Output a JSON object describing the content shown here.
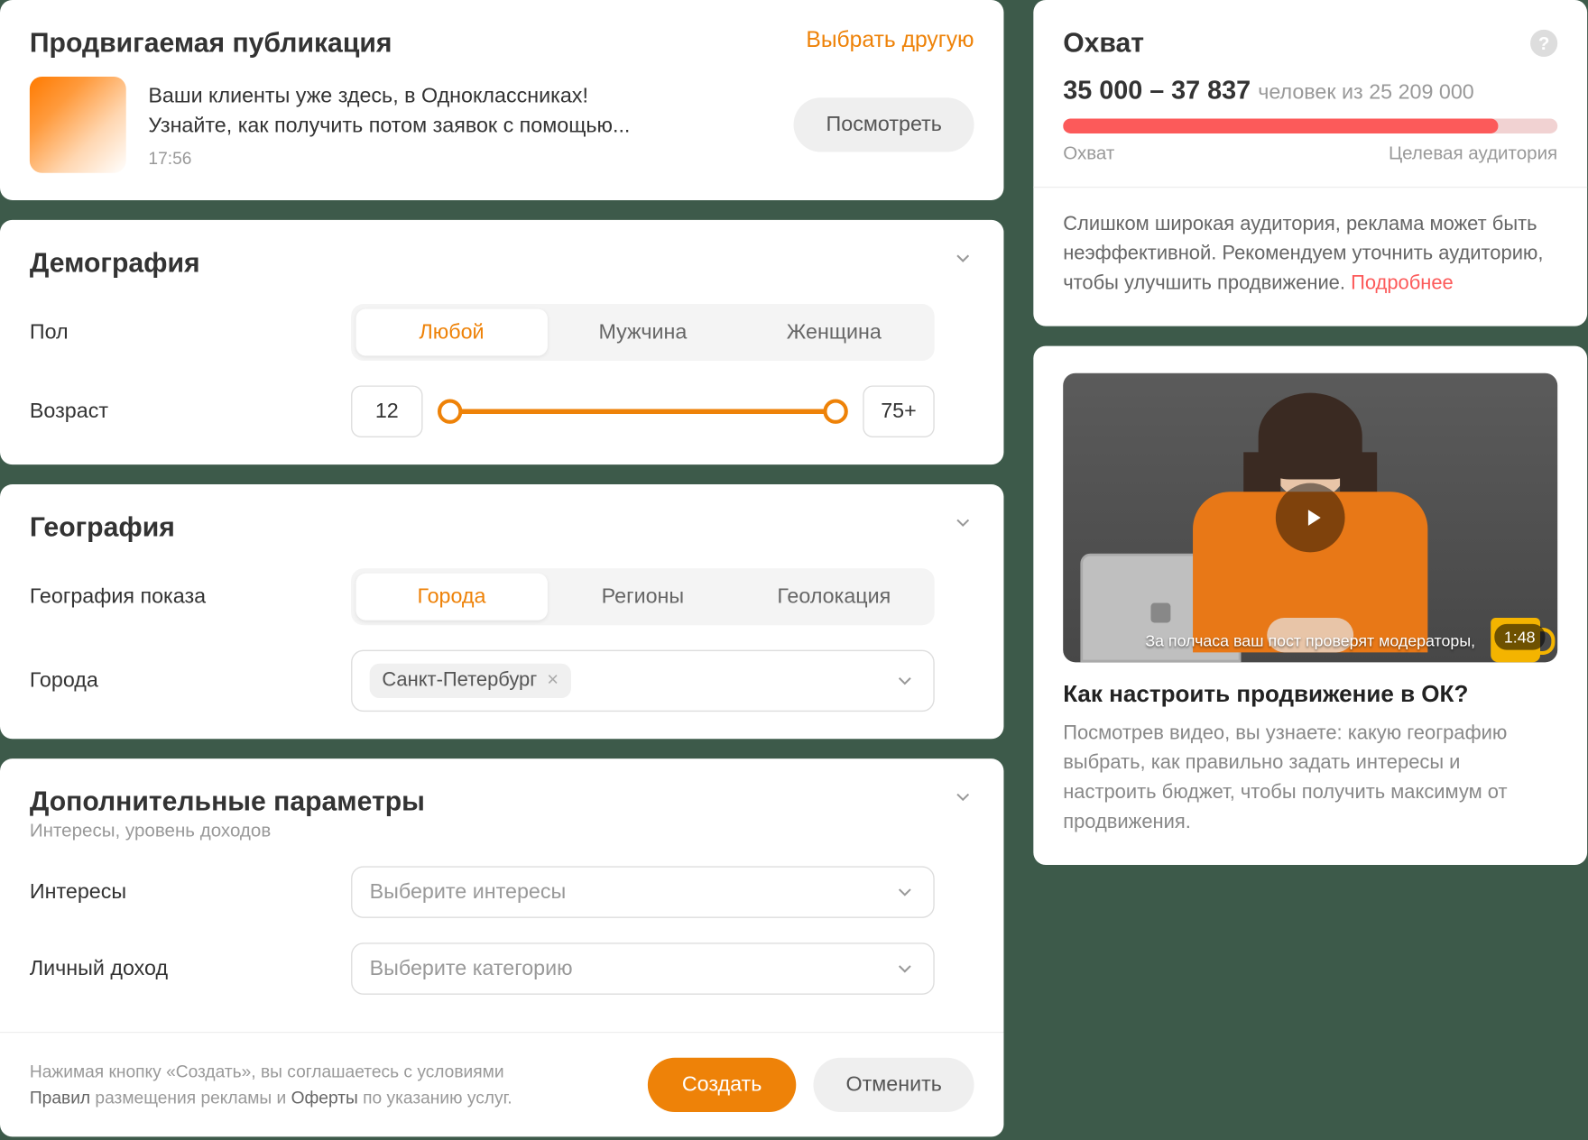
{
  "promoted": {
    "title": "Продвигаемая публикация",
    "change_link": "Выбрать другую",
    "text_line1": "Ваши клиенты уже здесь, в Одноклассниках!",
    "text_line2": "Узнайте, как получить потом заявок с помощью...",
    "time": "17:56",
    "view_btn": "Посмотреть"
  },
  "demo": {
    "title": "Демография",
    "gender_label": "Пол",
    "gender_options": {
      "any": "Любой",
      "male": "Мужчина",
      "female": "Женщина"
    },
    "age_label": "Возраст",
    "age_min": "12",
    "age_max": "75+"
  },
  "geo": {
    "title": "География",
    "type_label": "География показа",
    "type_options": {
      "cities": "Города",
      "regions": "Регионы",
      "geo": "Геолокация"
    },
    "cities_label": "Города",
    "city_chip": "Санкт-Петербург"
  },
  "params": {
    "title": "Дополнительные параметры",
    "subtitle": "Интересы, уровень доходов",
    "interests_label": "Интересы",
    "interests_placeholder": "Выберите интересы",
    "income_label": "Личный доход",
    "income_placeholder": "Выберите категорию"
  },
  "footer": {
    "legal_1": "Нажимая кнопку «Создать», вы соглашаетесь с условиями",
    "legal_rules": "Правил",
    "legal_2": " размещения рекламы и ",
    "legal_offer": "Оферты",
    "legal_3": " по указанию услуг.",
    "create": "Создать",
    "cancel": "Отменить"
  },
  "reach": {
    "title": "Охват",
    "range": "35 000 – 37 837",
    "people": "человек из 25 209 000",
    "bar_pct": 88,
    "label_left": "Охват",
    "label_right": "Целевая аудитория",
    "warn_text": "Слишком широкая аудитория, реклама может быть неэффективной. Рекомендуем уточнить аудиторию, чтобы улучшить продвижение. ",
    "warn_more": "Подробнее"
  },
  "video": {
    "duration": "1:48",
    "caption": "За полчаса ваш пост проверят модераторы,",
    "title": "Как настроить продвижение в ОК?",
    "desc": "Посмотрев видео, вы узнаете: какую географию выбрать, как правильно задать интересы и настроить бюджет, чтобы получить максимум от продвижения."
  }
}
